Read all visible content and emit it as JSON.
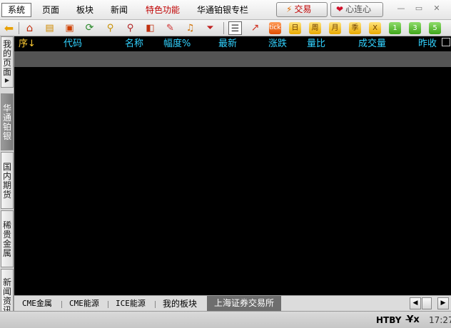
{
  "menu": {
    "items": [
      {
        "label": "系统"
      },
      {
        "label": "页面"
      },
      {
        "label": "板块"
      },
      {
        "label": "新闻"
      },
      {
        "label": "特色功能"
      },
      {
        "label": "华通铂银专栏"
      }
    ],
    "trade_label": "交易",
    "heart_label": "心连心"
  },
  "toolbar": {
    "icons": [
      "back-arrow-icon",
      "home-icon",
      "stack-icon",
      "fund-icon",
      "refresh-icon",
      "zoom-in-icon",
      "zoom-out-icon",
      "window-icon",
      "pen-icon",
      "bell-icon",
      "filter-icon",
      "quote-table-icon",
      "trend-chart-icon",
      "tick-icon"
    ],
    "tick_label": "tick",
    "periods": [
      {
        "label": "日"
      },
      {
        "label": "周"
      },
      {
        "label": "月"
      },
      {
        "label": "季"
      },
      {
        "label": "X"
      },
      {
        "label": "1"
      },
      {
        "label": "3"
      },
      {
        "label": "5"
      }
    ]
  },
  "sidebar": {
    "tabs": [
      {
        "label": "我的页面"
      },
      {
        "label": "华通铂银"
      },
      {
        "label": "国内期货"
      },
      {
        "label": "稀贵金属"
      },
      {
        "label": "新闻资讯"
      }
    ]
  },
  "grid": {
    "columns": [
      {
        "label": "序↓"
      },
      {
        "label": "代码"
      },
      {
        "label": "名称"
      },
      {
        "label": "幅度%"
      },
      {
        "label": "最新"
      },
      {
        "label": "涨跌"
      },
      {
        "label": "量比"
      },
      {
        "label": "成交量"
      },
      {
        "label": "昨收"
      }
    ],
    "rows": []
  },
  "bottom_tabs": [
    {
      "label": "CME金属"
    },
    {
      "label": "CME能源"
    },
    {
      "label": "ICE能源"
    },
    {
      "label": "我的板块"
    },
    {
      "label": "上海证券交易所"
    }
  ],
  "status": {
    "code": "HTBY",
    "time": "17:27"
  },
  "colors": {
    "header_text": "#32d2ff",
    "seq_header": "#ffcc33",
    "selected_row": "#545454",
    "menu_red": "#c00000"
  }
}
